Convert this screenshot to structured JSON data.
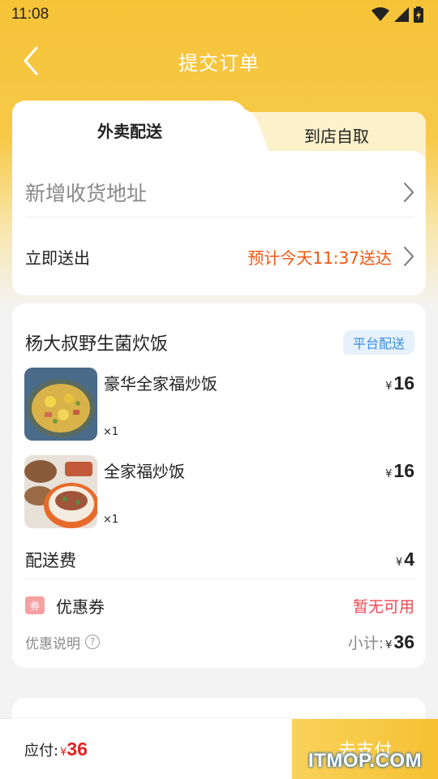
{
  "status_bar": {
    "time": "11:08"
  },
  "navbar": {
    "title": "提交订单"
  },
  "tabs": {
    "delivery": "外卖配送",
    "pickup": "到店自取"
  },
  "address": {
    "placeholder": "新增收货地址"
  },
  "delivery_time": {
    "label": "立即送出",
    "eta": "预计今天11:37送达"
  },
  "shop": {
    "name": "杨大叔野生菌炊饭",
    "badge": "平台配送"
  },
  "items": [
    {
      "name": "豪华全家福炒饭",
      "qty": "×1",
      "currency": "¥",
      "price": "16"
    },
    {
      "name": "全家福炒饭",
      "qty": "×1",
      "currency": "¥",
      "price": "16"
    }
  ],
  "fee": {
    "label": "配送费",
    "currency": "¥",
    "amount": "4"
  },
  "coupon": {
    "icon_text": "券",
    "label": "优惠券",
    "value": "暂无可用"
  },
  "note": {
    "label": "优惠说明",
    "subtotal_label": "小计:",
    "currency": "¥",
    "subtotal": "36"
  },
  "bottom": {
    "pay_label": "应付:",
    "currency": "¥",
    "amount": "36",
    "button": "去支付"
  },
  "watermark": "ITMOP.COM",
  "colors": {
    "accent": "#f6c338",
    "orange": "#f2560f",
    "red": "#e02222",
    "blue": "#3a8ee6"
  }
}
